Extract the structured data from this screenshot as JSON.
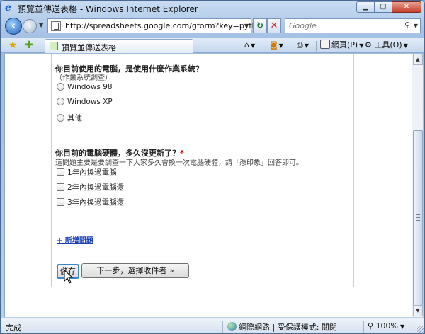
{
  "window": {
    "title": "預覽並傳送表格 - Windows Internet Explorer",
    "controls": {
      "minimize": "▁",
      "maximize": "▢",
      "close": "✕"
    }
  },
  "address_bar": {
    "url": "http://spreadsheets.google.com/gform?key=pytbFzE",
    "search_placeholder": "Google"
  },
  "tab": {
    "label": "預覽並傳送表格"
  },
  "command_bar": {
    "home_icon": "home-icon",
    "feeds_icon": "feeds-icon",
    "print_icon": "print-icon",
    "page_label": "網頁(P)",
    "tools_label": "工具(O)"
  },
  "form": {
    "q1": {
      "title": "你目前使用的電腦，是使用什麼作業系統？",
      "help": "（作業系統調查）",
      "options": [
        "Windows 98",
        "Windows XP",
        "其他"
      ]
    },
    "q2": {
      "title": "你目前的電腦硬體，多久沒更新了？",
      "required_mark": "*",
      "help": "這問題主要是要調查一下大家多久會換一次電腦硬體，請「憑印象」回答即可。",
      "options": [
        "1年內換過電腦",
        "2年內換過電腦還",
        "3年內換過電腦還"
      ]
    },
    "add_question_label": "+ 新增問題",
    "save_label": "儲存",
    "next_label": "下一步，選擇收件者 »"
  },
  "status_bar": {
    "status": "完成",
    "zone": "網際網路 | 受保護模式: 關閉",
    "zoom": "100%"
  }
}
